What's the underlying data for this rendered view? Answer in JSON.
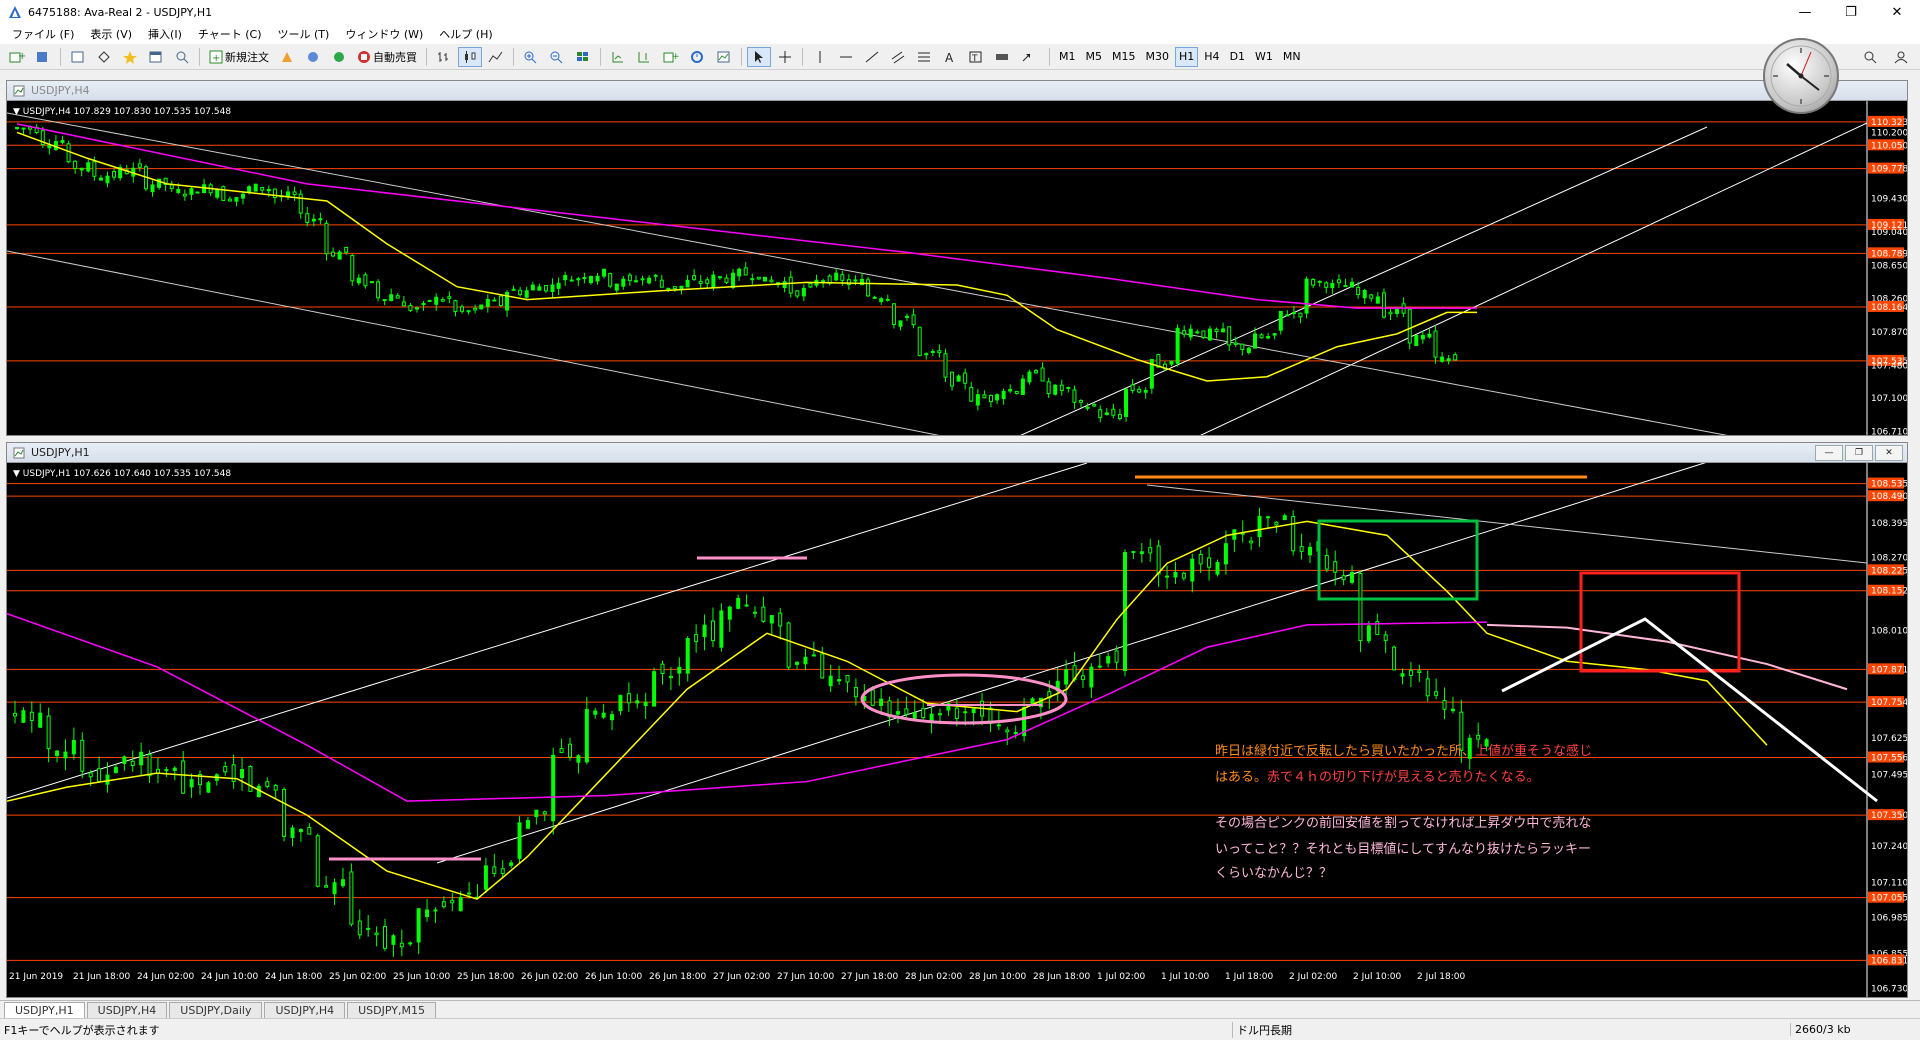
{
  "window": {
    "title": "6475188: Ava-Real 2 - USDJPY,H1",
    "minimize": "—",
    "restore": "❐",
    "close": "✕"
  },
  "menu": [
    "ファイル (F)",
    "表示 (V)",
    "挿入(I)",
    "チャート (C)",
    "ツール (T)",
    "ウィンドウ (W)",
    "ヘルプ (H)"
  ],
  "toolbar": {
    "new_order": "新規注文",
    "auto_trade": "自動売買",
    "timeframes": [
      "M1",
      "M5",
      "M15",
      "M30",
      "H1",
      "H4",
      "D1",
      "W1",
      "MN"
    ],
    "active_timeframe": "H1"
  },
  "h4_window": {
    "title": "USDJPY,H4",
    "info": "USDJPY,H4  107.829 107.830 107.535 107.548",
    "price_labels": [
      "110.323",
      "110.200",
      "110.050",
      "109.778",
      "109.430",
      "109.121",
      "109.040",
      "108.789",
      "108.650",
      "108.260",
      "108.164",
      "107.870",
      "107.535",
      "107.480",
      "107.100",
      "106.710"
    ],
    "hlines": [
      110.323,
      110.05,
      109.778,
      109.121,
      108.789,
      108.164,
      107.535
    ],
    "highlighted_labels": [
      "110.323",
      "110.050",
      "109.778",
      "109.121",
      "108.789",
      "108.164",
      "107.535"
    ],
    "ymax": 110.45,
    "ymin": 106.67
  },
  "h1_window": {
    "title": "USDJPY,H1",
    "info": "USDJPY,H1  107.626 107.640 107.535 107.548",
    "price_labels": [
      "108.535",
      "108.490",
      "108.395",
      "108.270",
      "108.225",
      "108.152",
      "108.010",
      "107.871",
      "107.754",
      "107.625",
      "107.556",
      "107.495",
      "107.350",
      "107.240",
      "107.110",
      "107.055",
      "106.985",
      "106.855",
      "106.831",
      "106.730"
    ],
    "highlighted_labels": [
      "108.535",
      "108.490",
      "108.225",
      "108.152",
      "107.871",
      "107.754",
      "107.556",
      "107.350",
      "107.055",
      "106.831"
    ],
    "hlines": [
      108.535,
      108.49,
      108.225,
      108.152,
      107.871,
      107.754,
      107.556,
      107.35,
      107.055,
      106.831
    ],
    "ymax": 108.58,
    "ymin": 106.7,
    "time_labels": [
      "21 Jun 2019",
      "21 Jun 18:00",
      "24 Jun 02:00",
      "24 Jun 10:00",
      "24 Jun 18:00",
      "25 Jun 02:00",
      "25 Jun 10:00",
      "25 Jun 18:00",
      "26 Jun 02:00",
      "26 Jun 10:00",
      "26 Jun 18:00",
      "27 Jun 02:00",
      "27 Jun 10:00",
      "27 Jun 18:00",
      "28 Jun 02:00",
      "28 Jun 10:00",
      "28 Jun 18:00",
      "1 Jul 02:00",
      "1 Jul 10:00",
      "1 Jul 18:00",
      "2 Jul 02:00",
      "2 Jul 10:00",
      "2 Jul 18:00"
    ],
    "annotation_lines": [
      [
        {
          "t": "昨日は緑付近で反転したら買いたかった所、",
          "c": "#ff8c1a"
        },
        {
          "t": "上値が重そうな感じ",
          "c": "#ff4040"
        }
      ],
      [
        {
          "t": "はある。",
          "c": "#ff8c1a"
        },
        {
          "t": "赤で４ｈの切り下げが見えると売りたくなる。",
          "c": "#ff4040"
        }
      ],
      [
        {
          "t": "",
          "c": "#ffffff"
        }
      ],
      [
        {
          "t": "その場合ピンクの前回安値を割ってなければ上昇ダウ中で売れな",
          "c": "#ffb6d9"
        }
      ],
      [
        {
          "t": "いってこと？？それとも目標値にしてすんなり抜けたらラッキー",
          "c": "#ffb6d9"
        }
      ],
      [
        {
          "t": "くらいなかんじ？？",
          "c": "#ffb6d9"
        }
      ]
    ]
  },
  "colors": {
    "candle": "#00ff00",
    "ma_short": "#ffff00",
    "ma_long": "#ff00ff",
    "hline": "#ff4500",
    "label_bg": "#ff4500",
    "channel": "#ffffff",
    "orange_line": "#ff8c1a",
    "pink": "#ff8fc8",
    "green_box": "#00c040",
    "red_box": "#ff2020"
  },
  "tabs": [
    "USDJPY,H1",
    "USDJPY,H4",
    "USDJPY,Daily",
    "USDJPY,H4",
    "USDJPY,M15"
  ],
  "active_tab": 0,
  "status": {
    "help": "F1キーでヘルプが表示されます",
    "profile": "ドル円長期",
    "traffic": "2660/3 kb"
  }
}
